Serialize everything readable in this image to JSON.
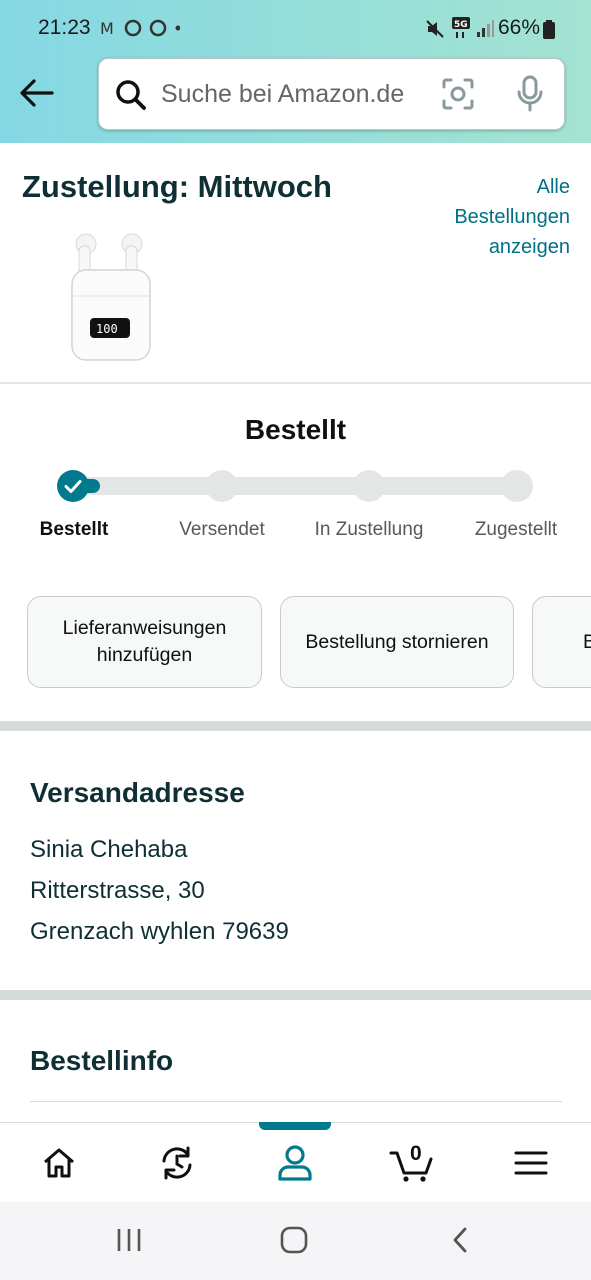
{
  "status_bar": {
    "time": "21:23",
    "left_icons": "M ◉ ◉ •",
    "battery": "66%"
  },
  "search": {
    "placeholder": "Suche bei Amazon.de"
  },
  "delivery": {
    "title": "Zustellung: Mittwoch",
    "all_orders_link": "Alle Bestellungen anzeigen"
  },
  "progress": {
    "title": "Bestellt",
    "steps": [
      "Bestellt",
      "Versendet",
      "In Zustellung",
      "Zugestellt"
    ],
    "current_step": 1
  },
  "actions": {
    "delivery_instructions": "Lieferanweisungen hinzufügen",
    "cancel_order": "Bestellung stornieren",
    "third_partial": "B"
  },
  "address": {
    "heading": "Versandadresse",
    "name": "Sinia Chehaba",
    "street": "Ritterstrasse, 30",
    "city": "Grenzach wyhlen 79639"
  },
  "order_info": {
    "heading": "Bestellinfo"
  },
  "bottom_nav": {
    "cart_count": "0",
    "active": "account"
  },
  "colors": {
    "accent": "#007a8c",
    "link": "#007185",
    "header_gradient_start": "#84d8e3",
    "header_gradient_end": "#a4e3d1"
  }
}
